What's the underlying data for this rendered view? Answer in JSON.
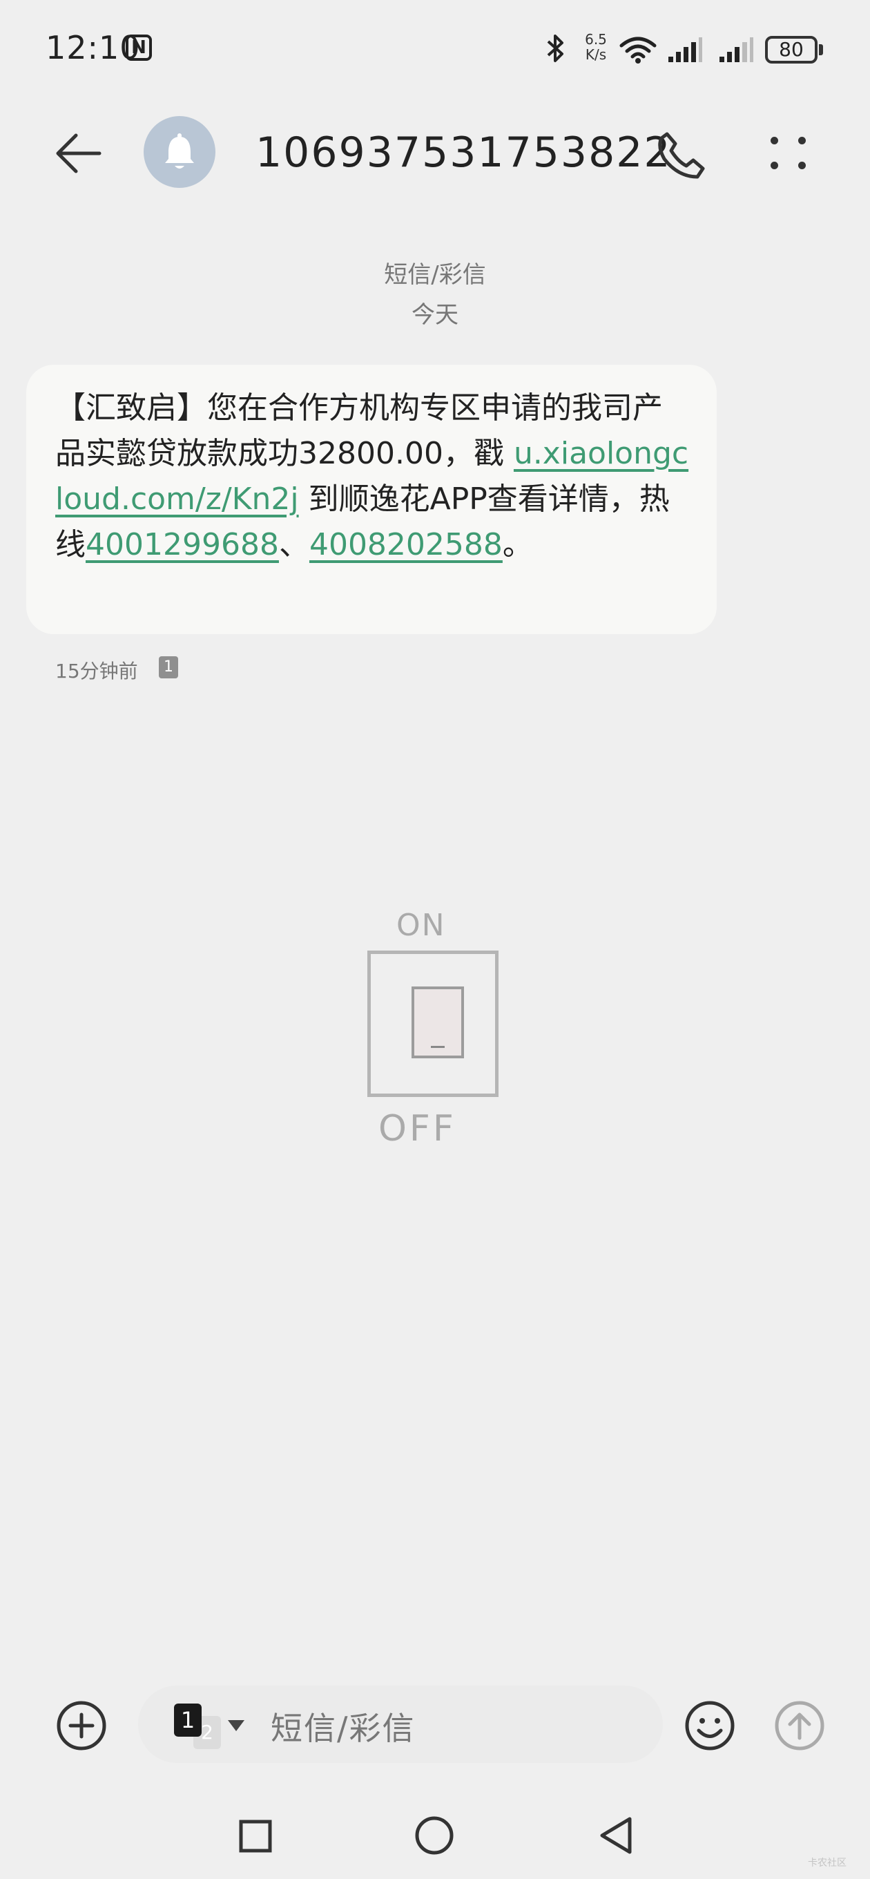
{
  "status_bar": {
    "time": "12:10",
    "nfc_label": "N",
    "net_speed_value": "6.5",
    "net_speed_unit": "K/s",
    "battery": "80"
  },
  "header": {
    "title": "106937531753822",
    "avatar_icon": "bell-icon"
  },
  "thread": {
    "type_label": "短信/彩信",
    "date_label": "今天"
  },
  "message": {
    "text_1": "【汇致启】您在合作方机构专区申请的我司产品实懿贷放款成功32800.00，戳 ",
    "link_url": "u.xiaolongcloud.com/z/Kn2j",
    "text_2": " 到顺逸花APP查看详情，热线",
    "phone_1": "4001299688",
    "text_3": "、",
    "phone_2": "4008202588",
    "text_4": "。",
    "time": "15分钟前",
    "sim_badge": "1"
  },
  "illustration": {
    "on_label": "ON",
    "off_label": "OFF"
  },
  "composer": {
    "sim_primary": "1",
    "sim_secondary": "2",
    "placeholder": "短信/彩信"
  },
  "watermark": "卡农社区",
  "colors": {
    "background": "#efefef",
    "bubble": "#f8f8f6",
    "link": "#3f9b73",
    "avatar": "#b9c6d5"
  }
}
